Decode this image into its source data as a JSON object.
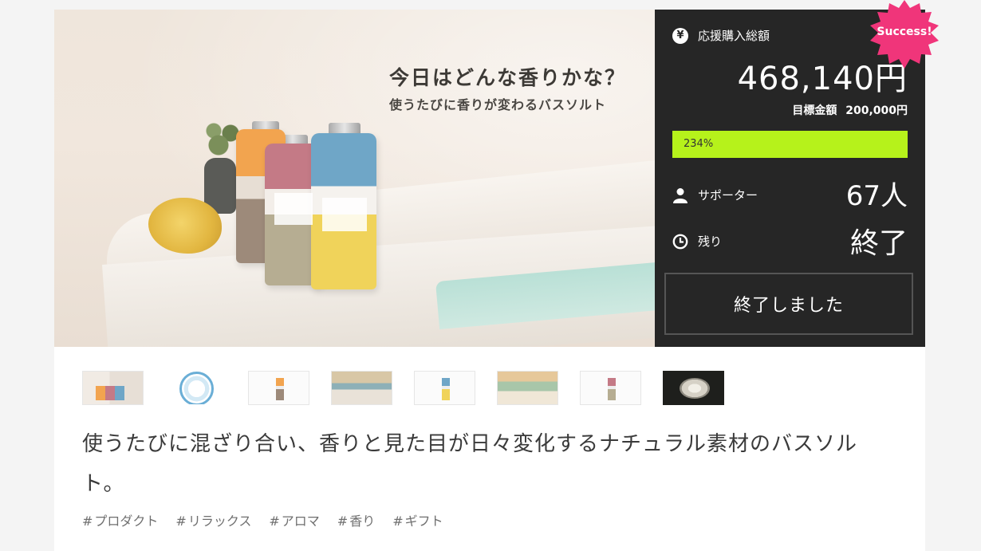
{
  "hero": {
    "title": "今日はどんな香りかな？",
    "subtitle": "使うたびに香りが変わるバスソルト"
  },
  "stats": {
    "total_label": "応援購入総額",
    "total_amount": "468,140円",
    "goal_label": "目標金額",
    "goal_amount": "200,000円",
    "progress_text": "234%",
    "progress_fraction": 1.0,
    "supporters_label": "サポーター",
    "supporters_count": "67人",
    "remaining_label": "残り",
    "remaining_value": "終了",
    "finish_button_label": "終了しました",
    "badge": "Success!",
    "colors": {
      "panel": "#262626",
      "progress": "#b6f21b",
      "badge": "#f0357a"
    }
  },
  "thumbnails": [
    "thumb-1",
    "thumb-2",
    "thumb-3",
    "thumb-4",
    "thumb-5",
    "thumb-6",
    "thumb-7",
    "thumb-8"
  ],
  "description": "使うたびに混ざり合い、香りと見た目が日々変化するナチュラル素材のバスソルト。",
  "tags": [
    "プロダクト",
    "リラックス",
    "アロマ",
    "香り",
    "ギフト"
  ]
}
